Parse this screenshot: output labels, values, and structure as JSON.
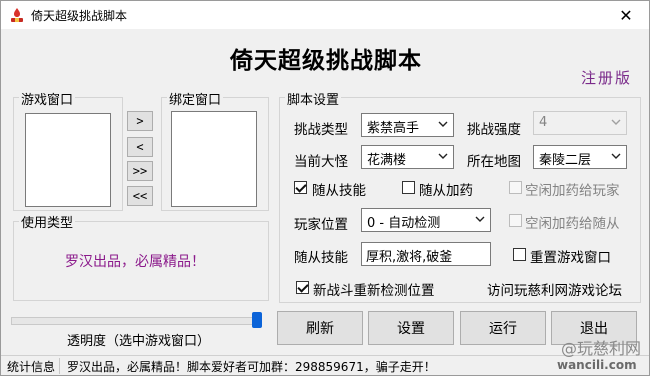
{
  "window": {
    "title": "倚天超级挑战脚本",
    "close_symbol": "✕"
  },
  "header": {
    "title": "倚天超级挑战脚本",
    "register_label": "注册版"
  },
  "game_window": {
    "label": "游戏窗口"
  },
  "bind_window": {
    "label": "绑定窗口"
  },
  "arrows": {
    "right": ">",
    "left": "<",
    "all_right": ">>",
    "all_left": "<<"
  },
  "usage_type": {
    "label": "使用类型",
    "slogan": "罗汉出品，必属精品！"
  },
  "transparency": {
    "label": "透明度（选中游戏窗口）",
    "level_fraction": 0.97
  },
  "script_settings": {
    "label": "脚本设置",
    "challenge_type": {
      "label": "挑战类型",
      "value": "紫禁高手"
    },
    "challenge_strength": {
      "label": "挑战强度",
      "value": "4"
    },
    "current_boss": {
      "label": "当前大怪",
      "value": "花满楼"
    },
    "map": {
      "label": "所在地图",
      "value": "秦陵二层"
    },
    "follow_skill_check": {
      "label": "随从技能",
      "checked": true
    },
    "follow_medicine_check": {
      "label": "随从加药",
      "checked": false
    },
    "idle_heal_player": {
      "label": "空闲加药给玩家",
      "checked": false
    },
    "player_position": {
      "label": "玩家位置",
      "value": "0 - 自动检测"
    },
    "idle_heal_follower": {
      "label": "空闲加药给随从",
      "checked": false
    },
    "follow_skill_input": {
      "label": "随从技能",
      "value": "厚积,激将,破釜"
    },
    "reset_game_window": {
      "label": "重置游戏窗口",
      "checked": false
    },
    "new_battle_recheck": {
      "label": "新战斗重新检测位置",
      "checked": true
    },
    "forum_link": "访问玩慈利网游戏论坛"
  },
  "buttons": {
    "refresh": "刷新",
    "settings": "设置",
    "run": "运行",
    "exit": "退出"
  },
  "status_bar": {
    "info_label": "统计信息",
    "message": "罗汉出品，必属精品！脚本爱好者可加群：298859671，骗子走开！"
  },
  "watermark": {
    "line1": "@玩慈利网",
    "line2": "wancili.com"
  },
  "colors": {
    "accent_purple": "#7a2a8a",
    "slider_blue": "#0b63d8"
  }
}
